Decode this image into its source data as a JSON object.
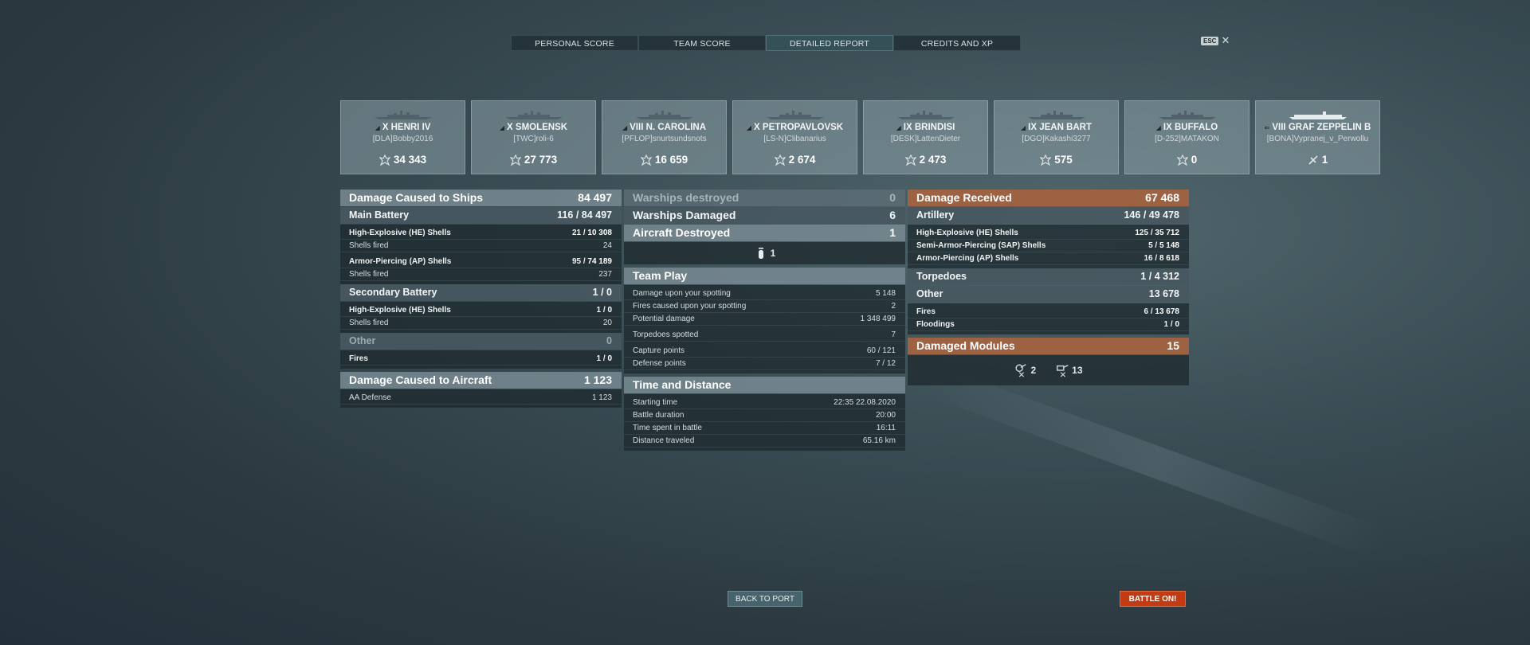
{
  "tabs": [
    {
      "label": "PERSONAL SCORE"
    },
    {
      "label": "TEAM SCORE"
    },
    {
      "label": "DETAILED REPORT"
    },
    {
      "label": "CREDITS AND XP"
    }
  ],
  "esc": {
    "key": "ESC",
    "close": "✕"
  },
  "ships": [
    {
      "tier": "X",
      "name": "HENRI IV",
      "player": "[DLA]Bobby2016",
      "value": "34 343"
    },
    {
      "tier": "X",
      "name": "SMOLENSK",
      "player": "[TWC]roli-6",
      "value": "27 773"
    },
    {
      "tier": "VIII",
      "name": "N. CAROLINA",
      "player": "[PFLOP]snurtsundsnots",
      "value": "16 659"
    },
    {
      "tier": "X",
      "name": "PETROPAVLOVSK",
      "player": "[LS-N]Clibanarius",
      "value": "2 674"
    },
    {
      "tier": "IX",
      "name": "BRINDISI",
      "player": "[DESK]LattenDieter",
      "value": "2 473"
    },
    {
      "tier": "IX",
      "name": "JEAN BART",
      "player": "[DGO]Kakashi3277",
      "value": "575"
    },
    {
      "tier": "IX",
      "name": "BUFFALO",
      "player": "[D-252]MATAKON",
      "value": "0"
    },
    {
      "tier": "VIII",
      "name": "GRAF ZEPPELIN B",
      "player": "[BONA]Vypranej_v_Perwollu",
      "value": "1"
    }
  ],
  "damage_ships": {
    "label": "Damage Caused to Ships",
    "value": "84 497",
    "main": {
      "label": "Main Battery",
      "hits": "116",
      "value": "84 497"
    },
    "he": {
      "label": "High-Explosive (HE) Shells",
      "hits": "21",
      "value": "10 308"
    },
    "he_fired": {
      "label": "Shells fired",
      "value": "24"
    },
    "ap": {
      "label": "Armor-Piercing (AP) Shells",
      "hits": "95",
      "value": "74 189"
    },
    "ap_fired": {
      "label": "Shells fired",
      "value": "237"
    },
    "secondary": {
      "label": "Secondary Battery",
      "hits": "1",
      "value": "0"
    },
    "sec_he": {
      "label": "High-Explosive (HE) Shells",
      "hits": "1",
      "value": "0"
    },
    "sec_fired": {
      "label": "Shells fired",
      "value": "20"
    },
    "other": {
      "label": "Other",
      "value": "0"
    },
    "fires": {
      "label": "Fires",
      "hits": "1",
      "value": "0"
    }
  },
  "damage_aircraft": {
    "label": "Damage Caused to Aircraft",
    "value": "1 123",
    "aa": {
      "label": "AA Defense",
      "value": "1 123"
    }
  },
  "center": {
    "destroyed": {
      "label": "Warships destroyed",
      "value": "0"
    },
    "damaged": {
      "label": "Warships Damaged",
      "value": "6"
    },
    "aircraft": {
      "label": "Aircraft Destroyed",
      "value": "1"
    },
    "aircraft_icon_count": "1",
    "team": {
      "label": "Team Play",
      "rows": [
        {
          "label": "Damage upon your spotting",
          "value": "5 148"
        },
        {
          "label": "Fires caused upon your spotting",
          "value": "2"
        },
        {
          "label": "Potential damage",
          "value": "1 348 499"
        },
        {
          "label": "Torpedoes spotted",
          "value": "7"
        },
        {
          "label": "Capture points",
          "value": "60 / 121"
        },
        {
          "label": "Defense points",
          "value": "7 / 12"
        }
      ]
    },
    "time": {
      "label": "Time and Distance",
      "rows": [
        {
          "label": "Starting time",
          "value": "22:35  22.08.2020"
        },
        {
          "label": "Battle duration",
          "value": "20:00"
        },
        {
          "label": "Time spent in battle",
          "value": "16:11"
        },
        {
          "label": "Distance traveled",
          "value": "65.16 km"
        }
      ]
    }
  },
  "received": {
    "label": "Damage Received",
    "value": "67 468",
    "artillery": {
      "label": "Artillery",
      "hits": "146",
      "value": "49 478"
    },
    "he": {
      "label": "High-Explosive (HE) Shells",
      "hits": "125",
      "value": "35 712"
    },
    "sap": {
      "label": "Semi-Armor-Piercing (SAP) Shells",
      "hits": "5",
      "value": "5 148"
    },
    "ap": {
      "label": "Armor-Piercing (AP) Shells",
      "hits": "16",
      "value": "8 618"
    },
    "torpedoes": {
      "label": "Torpedoes",
      "hits": "1",
      "value": "4 312"
    },
    "other": {
      "label": "Other",
      "value": "13 678"
    },
    "fires": {
      "label": "Fires",
      "hits": "6",
      "value": "13 678"
    },
    "floodings": {
      "label": "Floodings",
      "hits": "1",
      "value": "0"
    },
    "modules": {
      "label": "Damaged Modules",
      "value": "15",
      "items": [
        {
          "count": "2"
        },
        {
          "count": "13"
        }
      ]
    }
  },
  "buttons": {
    "back": "BACK TO PORT",
    "battle": "BATTLE ON!"
  }
}
